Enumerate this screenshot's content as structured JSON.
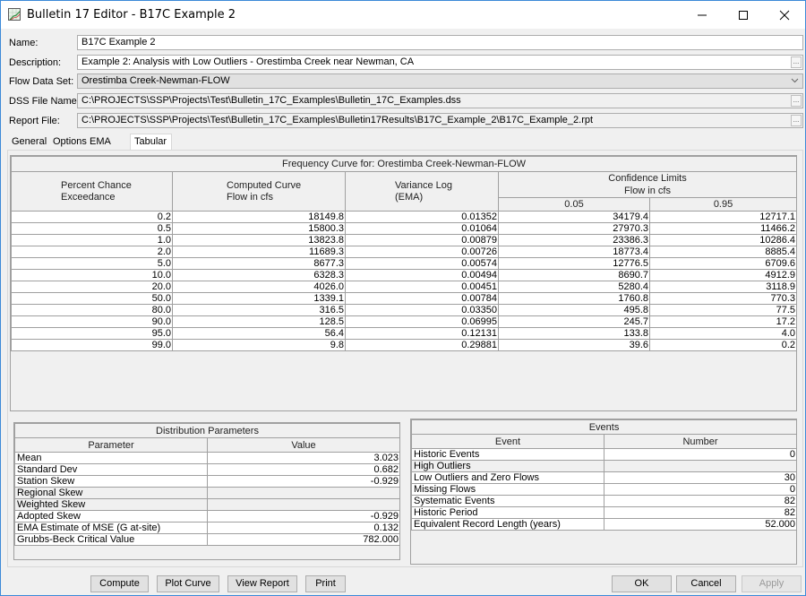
{
  "window": {
    "title": "Bulletin 17 Editor - B17C Example 2",
    "controls": {
      "minimize": "—",
      "maximize": "☐",
      "close": "✕"
    }
  },
  "form": {
    "name_label": "Name:",
    "name_value": "B17C Example 2",
    "description_label": "Description:",
    "description_value": "Example 2: Analysis with Low Outliers - Orestimba Creek near Newman, CA",
    "flow_data_set_label": "Flow Data Set:",
    "flow_data_set_value": "Orestimba Creek-Newman-FLOW",
    "dss_file_label": "DSS File Name:",
    "dss_file_value": "C:\\PROJECTS\\SSP\\Projects\\Test\\Bulletin_17C_Examples\\Bulletin_17C_Examples.dss",
    "report_file_label": "Report File:",
    "report_file_value": "C:\\PROJECTS\\SSP\\Projects\\Test\\Bulletin_17C_Examples\\Bulletin17Results\\B17C_Example_2\\B17C_Example_2.rpt",
    "ellipsis": "..."
  },
  "tabs": [
    {
      "label": "General",
      "active": false
    },
    {
      "label": "Options",
      "active": false
    },
    {
      "label": "EMA Data",
      "active": false
    },
    {
      "label": "Tabular Results",
      "active": true
    }
  ],
  "frequency_table": {
    "title": "Frequency Curve for: Orestimba Creek-Newman-FLOW",
    "headers": {
      "percent_chance_1": "Percent Chance",
      "percent_chance_2": "Exceedance",
      "computed_1": "Computed Curve",
      "computed_2": "Flow in cfs",
      "variance_1": "Variance Log",
      "variance_2": "(EMA)",
      "confidence_1": "Confidence Limits",
      "confidence_2": "Flow in cfs",
      "conf_low": "0.05",
      "conf_high": "0.95"
    },
    "rows": [
      {
        "pct": "0.2",
        "flow": "18149.8",
        "var": "0.01352",
        "c05": "34179.4",
        "c95": "12717.1"
      },
      {
        "pct": "0.5",
        "flow": "15800.3",
        "var": "0.01064",
        "c05": "27970.3",
        "c95": "11466.2"
      },
      {
        "pct": "1.0",
        "flow": "13823.8",
        "var": "0.00879",
        "c05": "23386.3",
        "c95": "10286.4"
      },
      {
        "pct": "2.0",
        "flow": "11689.3",
        "var": "0.00726",
        "c05": "18773.4",
        "c95": "8885.4"
      },
      {
        "pct": "5.0",
        "flow": "8677.3",
        "var": "0.00574",
        "c05": "12776.5",
        "c95": "6709.6"
      },
      {
        "pct": "10.0",
        "flow": "6328.3",
        "var": "0.00494",
        "c05": "8690.7",
        "c95": "4912.9"
      },
      {
        "pct": "20.0",
        "flow": "4026.0",
        "var": "0.00451",
        "c05": "5280.4",
        "c95": "3118.9"
      },
      {
        "pct": "50.0",
        "flow": "1339.1",
        "var": "0.00784",
        "c05": "1760.8",
        "c95": "770.3"
      },
      {
        "pct": "80.0",
        "flow": "316.5",
        "var": "0.03350",
        "c05": "495.8",
        "c95": "77.5"
      },
      {
        "pct": "90.0",
        "flow": "128.5",
        "var": "0.06995",
        "c05": "245.7",
        "c95": "17.2"
      },
      {
        "pct": "95.0",
        "flow": "56.4",
        "var": "0.12131",
        "c05": "133.8",
        "c95": "4.0"
      },
      {
        "pct": "99.0",
        "flow": "9.8",
        "var": "0.29881",
        "c05": "39.6",
        "c95": "0.2"
      }
    ]
  },
  "distribution": {
    "title": "Distribution Parameters",
    "col_parameter": "Parameter",
    "col_value": "Value",
    "rows": [
      {
        "param": "Mean",
        "value": "3.023",
        "editable": true
      },
      {
        "param": "Standard Dev",
        "value": "0.682",
        "editable": true
      },
      {
        "param": "Station Skew",
        "value": "-0.929",
        "editable": true
      },
      {
        "param": "Regional Skew",
        "value": "",
        "editable": false
      },
      {
        "param": "Weighted Skew",
        "value": "",
        "editable": false
      },
      {
        "param": "Adopted Skew",
        "value": "-0.929",
        "editable": true
      },
      {
        "param": "EMA Estimate of MSE (G at-site)",
        "value": "0.132",
        "editable": true
      },
      {
        "param": "Grubbs-Beck Critical Value",
        "value": "782.000",
        "editable": true
      }
    ]
  },
  "events": {
    "title": "Events",
    "col_event": "Event",
    "col_number": "Number",
    "rows": [
      {
        "event": "Historic Events",
        "number": "0",
        "editable": true
      },
      {
        "event": "High Outliers",
        "number": "",
        "editable": false
      },
      {
        "event": "Low Outliers and Zero Flows",
        "number": "30",
        "editable": true
      },
      {
        "event": "Missing Flows",
        "number": "0",
        "editable": true
      },
      {
        "event": "Systematic Events",
        "number": "82",
        "editable": true
      },
      {
        "event": "Historic Period",
        "number": "82",
        "editable": true
      },
      {
        "event": "Equivalent Record Length (years)",
        "number": "52.000",
        "editable": true
      }
    ]
  },
  "buttons": {
    "compute": "Compute",
    "plot_curve": "Plot Curve",
    "view_report": "View Report",
    "print": "Print",
    "ok": "OK",
    "cancel": "Cancel",
    "apply": "Apply"
  }
}
